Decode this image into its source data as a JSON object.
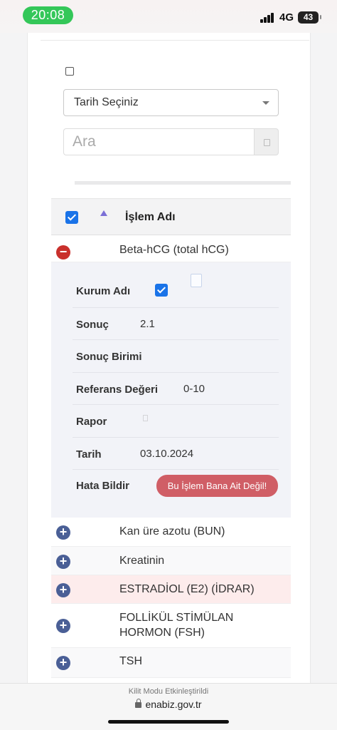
{
  "status_bar": {
    "time": "20:08",
    "network": "4G",
    "battery": "43"
  },
  "filters": {
    "date_select": "Tarih Seçiniz",
    "search_placeholder": "Ara"
  },
  "table": {
    "header_label": "İşlem Adı",
    "expanded_row": {
      "name": "Beta-hCG (total hCG)",
      "details": {
        "kurum_label": "Kurum Adı",
        "sonuc_label": "Sonuç",
        "sonuc_value": "2.1",
        "birim_label": "Sonuç Birimi",
        "referans_label": "Referans Değeri",
        "referans_value": "0-10",
        "rapor_label": "Rapor",
        "tarih_label": "Tarih",
        "tarih_value": "03.10.2024",
        "hata_label": "Hata Bildir",
        "hata_button": "Bu İşlem Bana Ait Değil!"
      }
    },
    "rows": [
      {
        "name": "Kan üre azotu (BUN)",
        "highlight": false
      },
      {
        "name": "Kreatinin",
        "highlight": false
      },
      {
        "name": "ESTRADİOL (E2) (İDRAR)",
        "highlight": true
      },
      {
        "name": "FOLLİKÜL STİMÜLAN HORMON (FSH)",
        "highlight": false
      },
      {
        "name": "TSH",
        "highlight": false
      }
    ]
  },
  "browser": {
    "lock_mode_note": "Kilit Modu Etkinleştirildi",
    "url": "enabiz.gov.tr"
  },
  "colors": {
    "status_pill": "#34c759",
    "checkbox": "#1a73e8",
    "minus_button": "#c9302c",
    "plus_button": "#4a5f96",
    "report_button": "#d05e66",
    "highlight_row": "#fdecec"
  }
}
